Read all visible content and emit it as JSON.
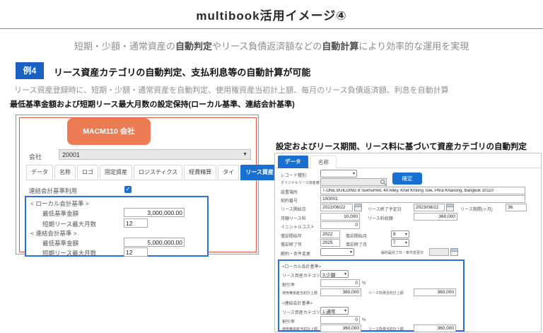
{
  "page": {
    "title": "multibook活用イメージ④",
    "subtitle": {
      "p1": "短期・少額・通常資産の",
      "b1": "自動判定",
      "p2": "やリース負債返済額などの",
      "b2": "自動計算",
      "p3": "により効率的な運用を実現"
    },
    "example": {
      "badge": "例4",
      "title": "リース資産カテゴリの自動判定、支払利息等の自動計算が可能",
      "description": "リース資産登録時に、短期・少額・通常資産を自動判定、使用権資産当初計上額、毎月のリース負債返済額、利息を自動計算"
    },
    "left_heading": "最低基準金額および短期リース最大月数の設定保持(ローカル基準、連結会計基準)",
    "right_heading": "設定およびリース期間、リース料に基づいて資産カテゴリの自動判定"
  },
  "colors": {
    "accent_blue": "#1a70d2",
    "badge_blue": "#1b61c4",
    "header_orange": "#ed7c55",
    "annotation_red": "#e2573d",
    "box_border_blue": "#2b6fe0"
  },
  "company_panel": {
    "header": "MACM110 会社",
    "company": {
      "label": "会社",
      "value": "20001"
    },
    "tabs": [
      "データ",
      "名称",
      "ロゴ",
      "固定資産",
      "ロジスティクス",
      "経費精算",
      "タイ",
      "リース資産"
    ],
    "active_tab": "リース資産",
    "consolidated_use_label": "連結会計基準利用",
    "consolidated_use_checked": true,
    "local": {
      "section": "< ローカル会計基準 >",
      "min_amount_label": "最低基準金額",
      "min_amount": "3,000,000.00",
      "max_months_label": "短期リース最大月数",
      "max_months": "12"
    },
    "consolidated": {
      "section": "< 連結会計基準 >",
      "min_amount_label": "最低基準金額",
      "min_amount": "5,000,000.00",
      "max_months_label": "短期リース最大月数",
      "max_months": "12"
    }
  },
  "lease_panel": {
    "tabs": [
      "データ",
      "名称"
    ],
    "active_tab": "データ",
    "record_type_label": "レコード種別",
    "original_asset_label": "オリジナルリース資産番号",
    "confirm_button": "確定",
    "location_label": "設置場所",
    "location_value": "T-ONE BUILDING 8 Sukhumvit, 40 Alley, Khet Khlong Toei, Phra Khanong, Bangkok 10110",
    "contract_label": "契約番号",
    "contract_value": "100001",
    "lease_start_label": "リース開始日",
    "lease_start_value": "2022/08/22",
    "lease_end_label": "リース終了予定日",
    "lease_end_value": "2023/08/22",
    "lease_term_label": "リース期間(ヶ月)",
    "lease_term_value": "36",
    "monthly_fee_label": "月額リース料",
    "monthly_fee_value": "10,000",
    "total_fee_label": "リース料総額",
    "total_fee_value": "360,000",
    "initial_cost_label": "イニシャルコスト",
    "initial_cost_value": "0",
    "dep_start_year_label": "償却開始年",
    "dep_start_year_value": "2022",
    "dep_start_month_label": "償却開始月",
    "dep_start_month_value": "8",
    "dep_end_year_label": "償却終了年",
    "dep_end_year_value": "2025",
    "dep_end_month_label": "償却終了月",
    "dep_end_month_value": "7",
    "cancel_label": "解約・条件変更",
    "cancel_date_label": "解約届完了日・条件変更日",
    "standards": [
      {
        "section": "<ローカル会計基準>",
        "category_label": "リース資産カテゴリ",
        "category_value": "3:少額",
        "discount_label": "割引率",
        "discount_value": "0",
        "discount_unit": "%",
        "rou_label": "使用権資産当初計上額",
        "rou_value": "360,000",
        "liability_label": "リース負債当初計上額",
        "liability_value": "360,000"
      },
      {
        "section": "<連結会計基準>",
        "category_label": "リース資産カテゴリ",
        "category_value": "1:通常",
        "discount_label": "割引率",
        "discount_value": "0",
        "discount_unit": "%",
        "rou_label": "使用権資産当初計上額",
        "rou_value": "360,000",
        "liability_label": "リース負債当初計上額",
        "liability_value": "360,000"
      }
    ]
  }
}
